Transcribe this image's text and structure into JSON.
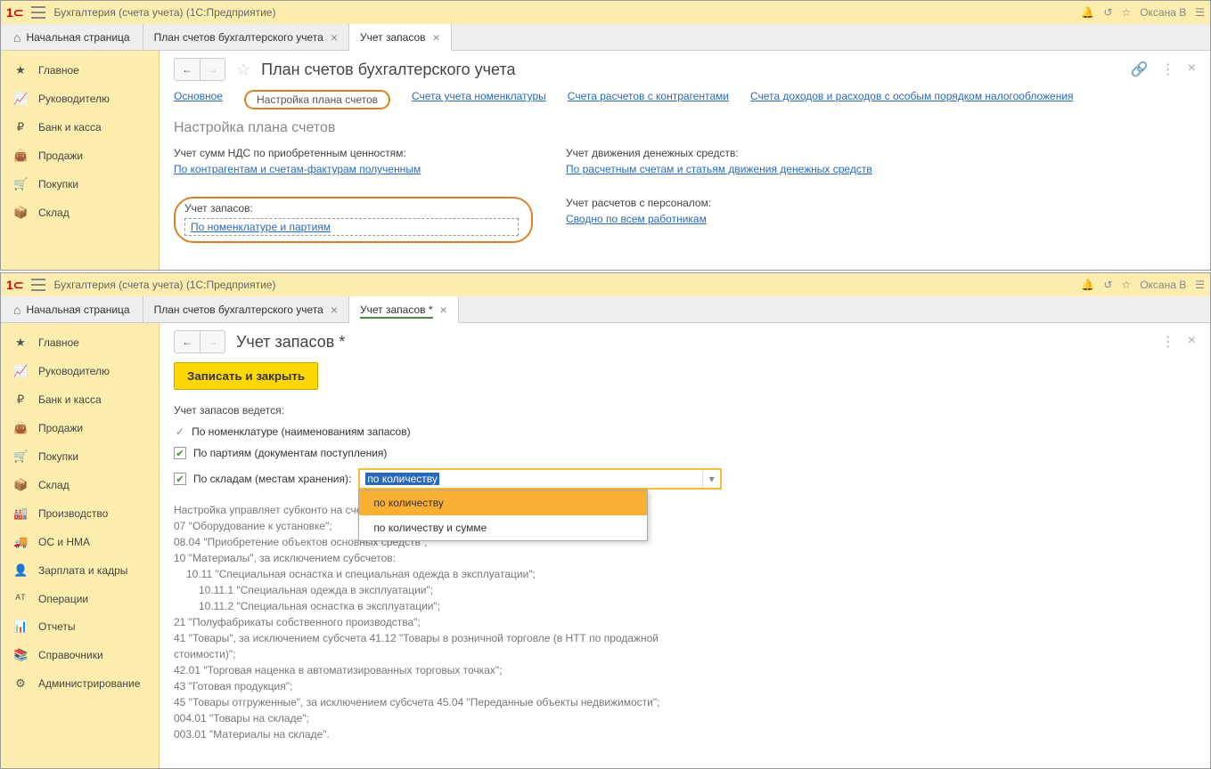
{
  "shared": {
    "app_title": "Бухгалтерия (счета учета)  (1С:Предприятие)",
    "user": "Оксана В",
    "home_tab": "Начальная страница",
    "tabs": {
      "plan": "План счетов бухгалтерского учета",
      "inventory": "Учет запасов",
      "inventory_mod": "Учет запасов *"
    }
  },
  "sidebar_top": [
    "Главное",
    "Руководителю",
    "Банк и касса",
    "Продажи",
    "Покупки",
    "Склад"
  ],
  "sidebar_bottom": [
    "Главное",
    "Руководителю",
    "Банк и касса",
    "Продажи",
    "Покупки",
    "Склад",
    "Производство",
    "ОС и НМА",
    "Зарплата и кадры",
    "Операции",
    "Отчеты",
    "Справочники",
    "Администрирование"
  ],
  "top_window": {
    "title": "План счетов бухгалтерского учета",
    "link_tabs": [
      "Основное",
      "Настройка плана счетов",
      "Счета учета номенклатуры",
      "Счета расчетов с контрагентами",
      "Счета доходов и расходов с особым порядком налогообложения"
    ],
    "section_title": "Настройка плана счетов",
    "nds_label": "Учет сумм НДС по приобретенным ценностям:",
    "nds_link": "По контрагентам и счетам-фактурам полученным",
    "cash_label": "Учет движения денежных средств:",
    "cash_link": "По расчетным счетам и статьям движения денежных средств",
    "inv_label": "Учет запасов:",
    "inv_link": "По номенклатуре и партиям",
    "pers_label": "Учет расчетов с персоналом:",
    "pers_link": "Сводно по всем работникам"
  },
  "bottom_window": {
    "title": "Учет запасов *",
    "save_btn": "Записать и закрыть",
    "legend": "Учет запасов ведется:",
    "by_nomen": "По номенклатуре (наименованиям запасов)",
    "by_party": "По партиям (документам поступления)",
    "by_store": "По складам (местам хранения):",
    "select_value": "по количеству",
    "dropdown": [
      "по количеству",
      "по количеству и сумме"
    ],
    "desc": [
      "Настройка управляет субконто на счетах:",
      "07 \"Оборудование к установке\";",
      "08.04 \"Приобретение объектов основных средств\";",
      "10 \"Материалы\", за исключением субсчетов:",
      "10.11 \"Специальная оснастка и специальная одежда в эксплуатации\";",
      "10.11.1 \"Специальная одежда в эксплуатации\";",
      "10.11.2 \"Специальная оснастка в эксплуатации\";",
      "21 \"Полуфабрикаты собственного производства\";",
      "41 \"Товары\", за исключением субсчета 41.12 \"Товары в розничной торговле (в НТТ по продажной стоимости)\";",
      "42.01 \"Торговая наценка в автоматизированных торговых точках\";",
      "43 \"Готовая продукция\";",
      "45 \"Товары отгруженные\", за исключением субсчета 45.04 \"Переданные объекты недвижимости\";",
      "004.01 \"Товары на складе\";",
      "003.01 \"Материалы на складе\"."
    ]
  }
}
